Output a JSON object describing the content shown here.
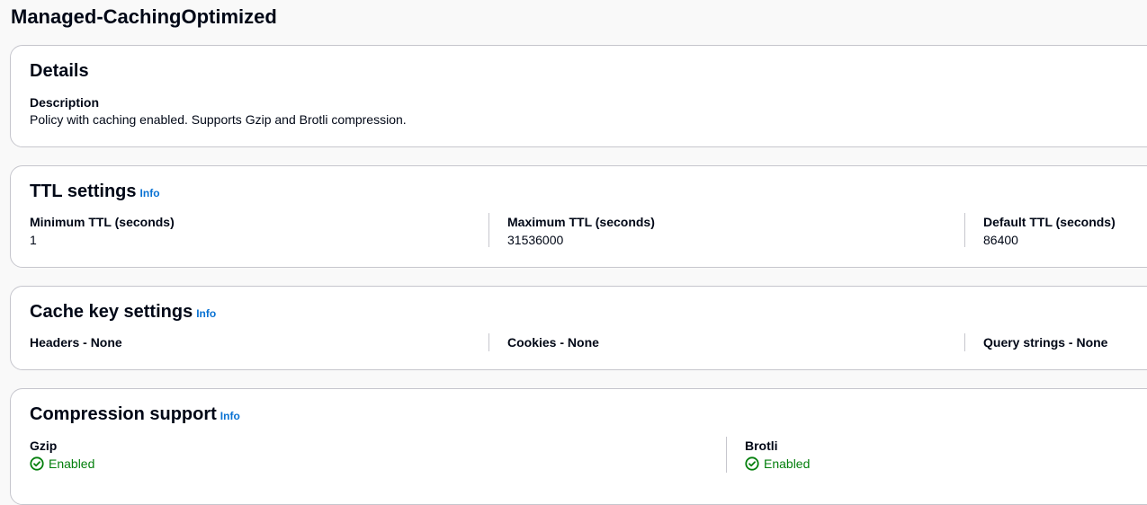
{
  "page": {
    "title": "Managed-CachingOptimized"
  },
  "details": {
    "title": "Details",
    "description_label": "Description",
    "description_value": "Policy with caching enabled. Supports Gzip and Brotli compression."
  },
  "ttl": {
    "title": "TTL settings",
    "info": "Info",
    "fields": [
      {
        "label": "Minimum TTL (seconds)",
        "value": "1"
      },
      {
        "label": "Maximum TTL (seconds)",
        "value": "31536000"
      },
      {
        "label": "Default TTL (seconds)",
        "value": "86400"
      }
    ]
  },
  "cache_key": {
    "title": "Cache key settings",
    "info": "Info",
    "fields": [
      {
        "label": "Headers - None"
      },
      {
        "label": "Cookies - None"
      },
      {
        "label": "Query strings - None"
      }
    ]
  },
  "compression": {
    "title": "Compression support",
    "info": "Info",
    "fields": [
      {
        "label": "Gzip",
        "status": "Enabled",
        "status_icon": "status-positive-icon"
      },
      {
        "label": "Brotli",
        "status": "Enabled",
        "status_icon": "status-positive-icon"
      }
    ]
  },
  "colors": {
    "link": "#0972d3",
    "success": "#037f0c",
    "border": "#c6c6cd"
  }
}
